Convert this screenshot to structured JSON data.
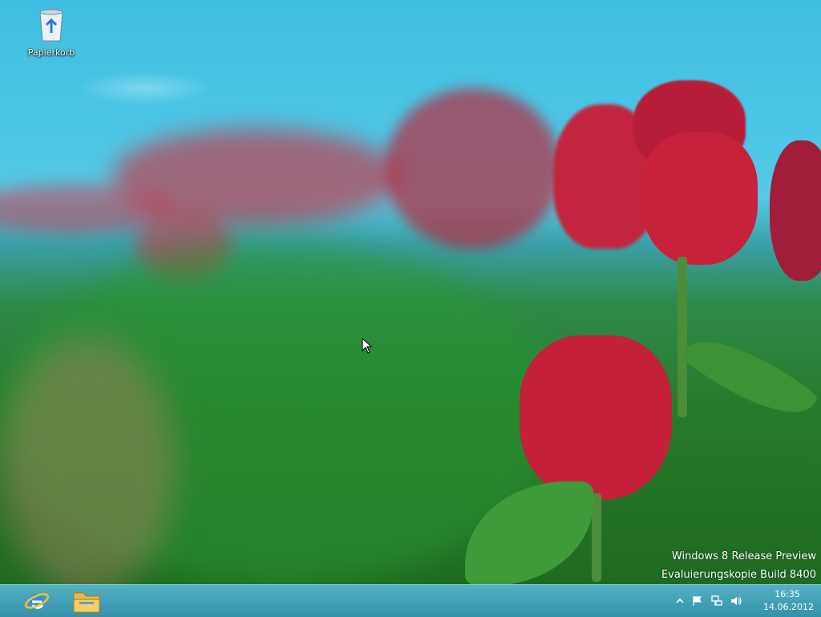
{
  "desktop": {
    "icons": [
      {
        "label": "Papierkorb",
        "icon": "recycle-bin-icon"
      }
    ],
    "watermark": {
      "line1": "Windows 8 Release Preview",
      "line2": "Evaluierungskopie Build 8400"
    }
  },
  "taskbar": {
    "pinned": [
      {
        "icon": "internet-explorer-icon"
      },
      {
        "icon": "file-explorer-icon"
      }
    ],
    "tray": {
      "icons": [
        "show-hidden-icons-chevron",
        "action-center-flag-icon",
        "network-icon",
        "volume-icon"
      ],
      "time": "16:35",
      "date": "14.06.2012"
    }
  }
}
